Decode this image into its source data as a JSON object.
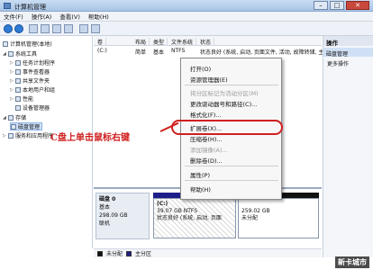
{
  "window": {
    "title": "计算机管理",
    "minimize": "–",
    "maximize": "□",
    "close": "✕"
  },
  "menu": [
    "文件(F)",
    "操作(A)",
    "查看(V)",
    "帮助(H)"
  ],
  "tree": {
    "root": "计算机管理(本地)",
    "system_tools": "系统工具",
    "task_scheduler": "任务计划程序",
    "event_viewer": "事件查看器",
    "shared_folders": "共享文件夹",
    "local_users": "本地用户和组",
    "performance": "性能",
    "device_manager": "设备管理器",
    "storage": "存储",
    "disk_management": "磁盘管理",
    "services": "服务和应用程序"
  },
  "volume_table": {
    "headers": [
      "卷",
      "布局",
      "类型",
      "文件系统",
      "状态"
    ],
    "row": {
      "volume": "(C:)",
      "layout": "简单",
      "type": "基本",
      "fs": "NTFS",
      "status": "状态良好 (系统, 启动, 页面文件, 活动, 故障转储, 主分区)"
    }
  },
  "disk": {
    "name": "磁盘 0",
    "type": "基本",
    "size": "298.09 GB",
    "state": "联机",
    "partition_c": {
      "label": "(C:)",
      "size": "39.07 GB NTFS",
      "status": "状态良好 (系统, 启动, 页面"
    },
    "unallocated": {
      "size": "259.02 GB",
      "status": "未分配"
    }
  },
  "legend": {
    "unallocated": "未分配",
    "primary": "主分区"
  },
  "actions": {
    "title": "操作",
    "item": "磁盘管理",
    "more": "更多操作"
  },
  "context_menu": {
    "open": "打开(O)",
    "explore": "资源管理器(E)",
    "mark_active": "将分区标记为活动分区(M)",
    "change_letter": "更改驱动器号和路径(C)...",
    "format": "格式化(F)...",
    "extend": "扩展卷(X)...",
    "shrink": "压缩卷(H)...",
    "add_mirror": "添加镜像(A)...",
    "delete": "删除卷(D)...",
    "properties": "属性(P)",
    "help": "帮助(H)"
  },
  "annotation": "C盘上单击鼠标右键",
  "watermark": "新卡城市",
  "colors": {
    "accent_red": "#d01f1f",
    "primary_partition": "#1e1e8a",
    "unallocated": "#111111"
  }
}
